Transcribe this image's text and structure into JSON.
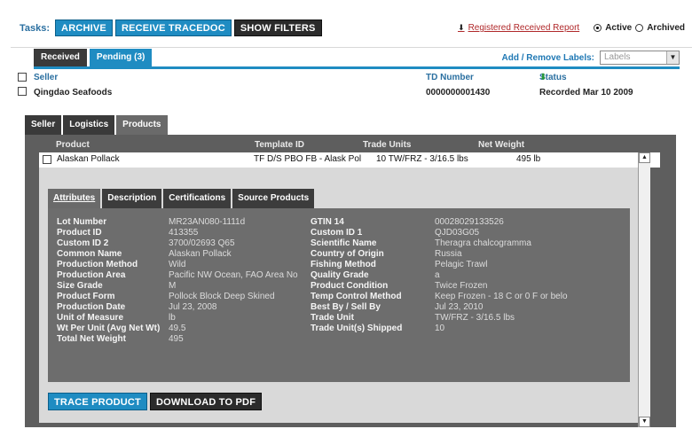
{
  "taskbar": {
    "tasks_label": "Tasks:",
    "buttons": [
      "ARCHIVE",
      "RECEIVE TRACEDOC",
      "SHOW FILTERS"
    ],
    "report_link": "Registered Received Report",
    "radio_active": "Active",
    "radio_archived": "Archived"
  },
  "list_tabs": {
    "received": "Received",
    "pending": "Pending (3)"
  },
  "labels": {
    "link": "Add / Remove Labels:",
    "select_value": "Labels"
  },
  "table": {
    "col_seller": "Seller",
    "col_td_number": "TD Number",
    "col_status": "Status",
    "row": {
      "seller": "Qingdao Seafoods",
      "td_number": "0000000001430",
      "status": "Recorded Mar 10 2009"
    }
  },
  "detail_tabs": [
    "Seller",
    "Logistics",
    "Products"
  ],
  "products": {
    "headers": {
      "product": "Product",
      "template": "Template ID",
      "units": "Trade Units",
      "weight": "Net Weight"
    },
    "row": {
      "product": "Alaskan Pollack",
      "template": "TF D/S PBO FB - Alask Pol",
      "units": "10 TW/FRZ - 3/16.5 lbs",
      "weight": "495 lb"
    }
  },
  "inner_tabs": [
    "Attributes",
    "Description",
    "Certifications",
    "Source Products"
  ],
  "attributes": {
    "left": [
      {
        "k": "Lot Number",
        "v": "MR23AN080-1111d"
      },
      {
        "k": "Product ID",
        "v": "413355"
      },
      {
        "k": "Custom ID 2",
        "v": "3700/02693 Q65"
      },
      {
        "k": "Common Name",
        "v": "Alaskan Pollack"
      },
      {
        "k": "Production Method",
        "v": "Wild"
      },
      {
        "k": "Production Area",
        "v": "Pacific NW Ocean, FAO Area No"
      },
      {
        "k": "Size Grade",
        "v": "M"
      },
      {
        "k": "Product Form",
        "v": "Pollock Block Deep Skined"
      },
      {
        "k": "Production Date",
        "v": "Jul 23, 2008"
      },
      {
        "k": "Unit of Measure",
        "v": "lb"
      },
      {
        "k": "Wt Per Unit (Avg Net Wt)",
        "v": "49.5"
      },
      {
        "k": "Total Net Weight",
        "v": "495"
      }
    ],
    "right": [
      {
        "k": "GTIN 14",
        "v": "00028029133526"
      },
      {
        "k": "Custom ID 1",
        "v": "QJD03G05"
      },
      {
        "k": "Scientific Name",
        "v": "Theragra chalcogramma"
      },
      {
        "k": "Country of Origin",
        "v": "Russia"
      },
      {
        "k": "Fishing Method",
        "v": "Pelagic Trawl"
      },
      {
        "k": "Quality Grade",
        "v": "a"
      },
      {
        "k": "Product Condition",
        "v": "Twice Frozen"
      },
      {
        "k": "Temp Control Method",
        "v": "Keep Frozen - 18 C or 0 F or belo"
      },
      {
        "k": "Best By / Sell By",
        "v": "Jul 23, 2010"
      },
      {
        "k": "Trade Unit",
        "v": "TW/FRZ - 3/16.5 lbs"
      },
      {
        "k": "Trade Unit(s) Shipped",
        "v": "10"
      }
    ]
  },
  "actions": {
    "trace": "TRACE PRODUCT",
    "download": "DOWNLOAD TO PDF"
  },
  "colors": {
    "accent": "#1f8cc2",
    "panel": "#5e5e5e",
    "link_red": "#b0282a"
  }
}
